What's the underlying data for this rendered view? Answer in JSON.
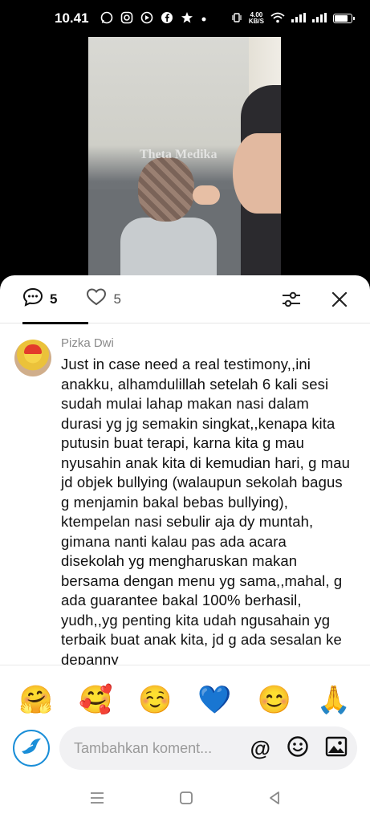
{
  "status_bar": {
    "time": "10.41",
    "net_speed_value": "4.00",
    "net_speed_unit": "KB/S",
    "app_icons": [
      "whatsapp-icon",
      "instagram-icon",
      "viber-icon",
      "facebook-icon",
      "star-icon",
      "dot-icon"
    ],
    "battery_level": 0.85
  },
  "video": {
    "watermark": "Theta Medika"
  },
  "tabs": {
    "comments_count": "5",
    "likes_count": "5"
  },
  "comment": {
    "username": "Pizka Dwi",
    "text": "Just in case need a real testimony,,ini anakku, alhamdulillah setelah 6 kali sesi sudah mulai lahap makan nasi dalam durasi yg jg semakin singkat,,kenapa kita putusin buat terapi, karna kita g mau nyusahin anak kita di kemudian hari, g mau jd objek bullying (walaupun sekolah bagus g menjamin bakal bebas bullying), ktempelan nasi sebulir aja dy muntah, gimana nanti kalau pas ada acara disekolah yg mengharuskan makan bersama dengan menu yg sama,,mahal, g ada guarantee bakal 100% berhasil, yudh,,yg penting kita udah ngusahain yg terbaik buat anak kita, jd g ada sesalan ke depanny"
  },
  "emoji_bar": [
    "🤗",
    "🥰",
    "☺️",
    "💙",
    "😊",
    "🙏"
  ],
  "composer": {
    "placeholder": "Tambahkan koment...",
    "at_label": "@"
  },
  "colors": {
    "accent": "#1a8ed8",
    "background": "#ffffff",
    "text": "#111111",
    "muted": "#8a8a8a"
  }
}
